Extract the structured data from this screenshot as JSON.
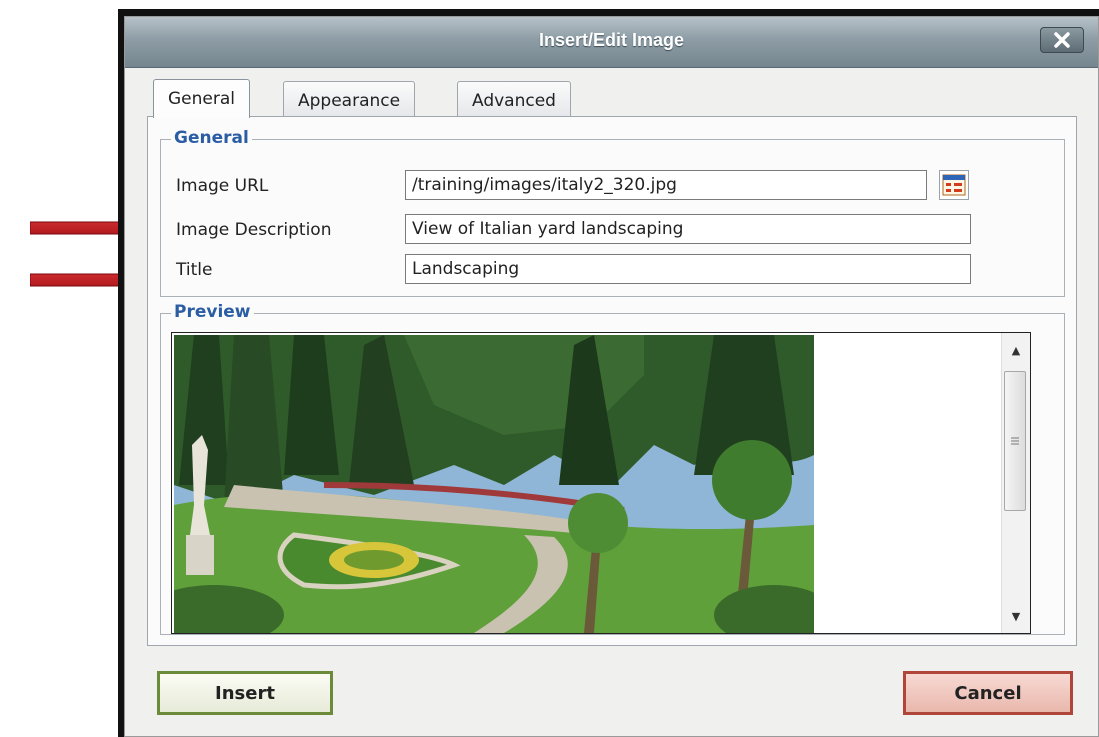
{
  "dialog": {
    "title": "Insert/Edit Image",
    "close_icon": "close-icon"
  },
  "tabs": [
    {
      "label": "General",
      "active": true
    },
    {
      "label": "Appearance",
      "active": false
    },
    {
      "label": "Advanced",
      "active": false
    }
  ],
  "general_section": {
    "legend": "General",
    "image_url_label": "Image URL",
    "image_url_value": "/training/images/italy2_320.jpg",
    "browse_icon": "file-browser-icon",
    "image_description_label": "Image Description",
    "image_description_value": "View of Italian yard landscaping",
    "title_label": "Title",
    "title_value": "Landscaping"
  },
  "preview_section": {
    "legend": "Preview",
    "image_subject": "italian-garden-landscape-photo"
  },
  "footer": {
    "insert_label": "Insert",
    "cancel_label": "Cancel"
  },
  "annotations": {
    "arrow_color": "#c0141c",
    "arrow_targets": [
      "Image Description",
      "Title"
    ]
  }
}
